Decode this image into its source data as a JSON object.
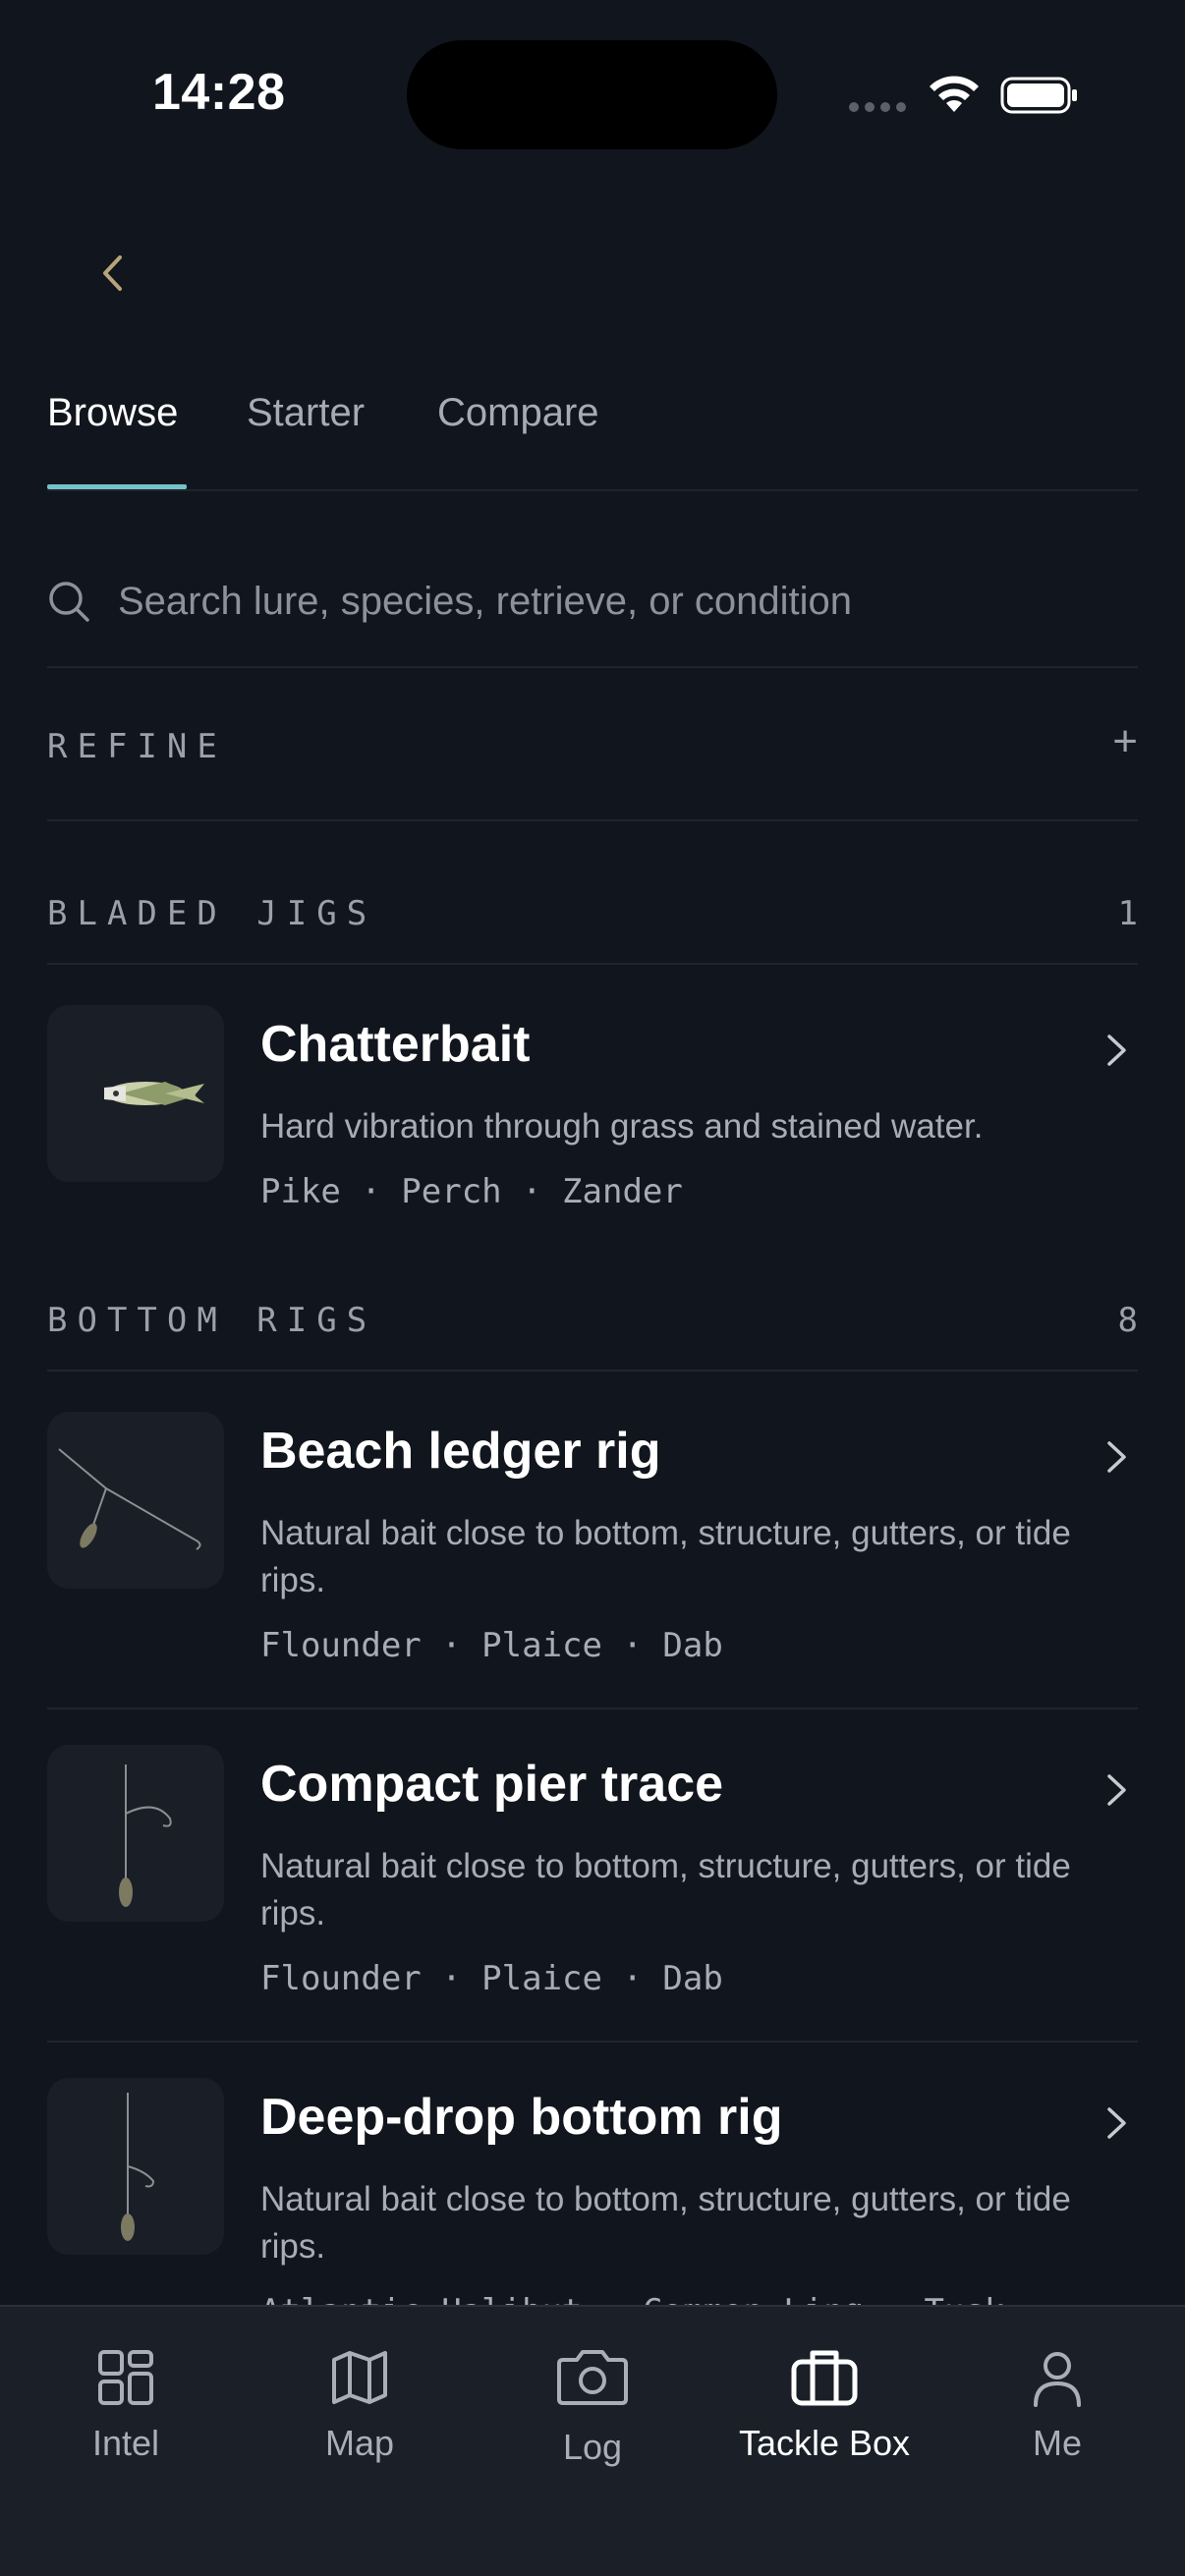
{
  "status_bar": {
    "time": "14:28"
  },
  "tabs": [
    {
      "label": "Browse",
      "active": true
    },
    {
      "label": "Starter",
      "active": false
    },
    {
      "label": "Compare",
      "active": false
    }
  ],
  "search": {
    "placeholder": "Search lure, species, retrieve, or condition",
    "value": ""
  },
  "refine": {
    "label": "REFINE",
    "toggle_icon": "plus-icon"
  },
  "sections": [
    {
      "title": "BLADED JIGS",
      "count": "1",
      "items": [
        {
          "title": "Chatterbait",
          "description": "Hard vibration through grass and stained water.",
          "species": "Pike · Perch · Zander",
          "image": "chatterbait-image"
        }
      ]
    },
    {
      "title": "BOTTOM RIGS",
      "count": "8",
      "items": [
        {
          "title": "Beach ledger rig",
          "description": "Natural bait close to bottom, structure, gutters, or tide rips.",
          "species": "Flounder · Plaice · Dab",
          "image": "beach-ledger-rig-image"
        },
        {
          "title": "Compact pier trace",
          "description": "Natural bait close to bottom, structure, gutters, or tide rips.",
          "species": "Flounder · Plaice · Dab",
          "image": "compact-pier-trace-image"
        },
        {
          "title": "Deep-drop bottom rig",
          "description": "Natural bait close to bottom, structure, gutters, or tide rips.",
          "species": "Atlantic Halibut · Common Ling · Tusk",
          "image": "deep-drop-bottom-rig-image"
        }
      ]
    }
  ],
  "bottom_nav": [
    {
      "label": "Intel",
      "icon": "grid-icon",
      "active": false
    },
    {
      "label": "Map",
      "icon": "map-icon",
      "active": false
    },
    {
      "label": "Log",
      "icon": "camera-icon",
      "active": false
    },
    {
      "label": "Tackle Box",
      "icon": "tackle-box-icon",
      "active": true
    },
    {
      "label": "Me",
      "icon": "person-icon",
      "active": false
    }
  ],
  "colors": {
    "background": "#11151d",
    "accent": "#74c3c9",
    "back_chevron": "#b8a47a",
    "muted_text": "#a7adb6",
    "nav_background": "#1a1f28"
  }
}
